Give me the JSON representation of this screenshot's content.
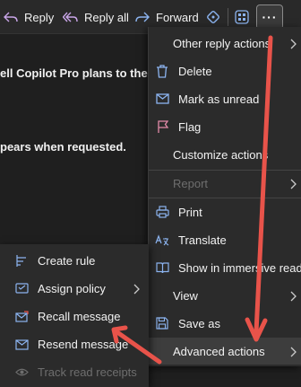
{
  "toolbar": {
    "reply": "Reply",
    "reply_all": "Reply all",
    "forward": "Forward",
    "more": "···"
  },
  "email": {
    "line1": "ell Copilot Pro plans to the pe",
    "line2": "pears when requested."
  },
  "main_menu": {
    "other_reply_actions": "Other reply actions",
    "delete": "Delete",
    "mark_unread": "Mark as unread",
    "flag": "Flag",
    "customize": "Customize actions",
    "report": "Report",
    "print": "Print",
    "translate": "Translate",
    "immersive": "Show in immersive reader",
    "view": "View",
    "save_as": "Save as",
    "advanced": "Advanced actions"
  },
  "sub_menu": {
    "create_rule": "Create rule",
    "assign_policy": "Assign policy",
    "recall": "Recall message",
    "resend": "Resend message",
    "track": "Track read receipts"
  },
  "colors": {
    "background": "#1f1f1f",
    "menu": "#2b2b2b",
    "accent_icon": "#8cb4f0",
    "arrow": "#e8534a"
  }
}
